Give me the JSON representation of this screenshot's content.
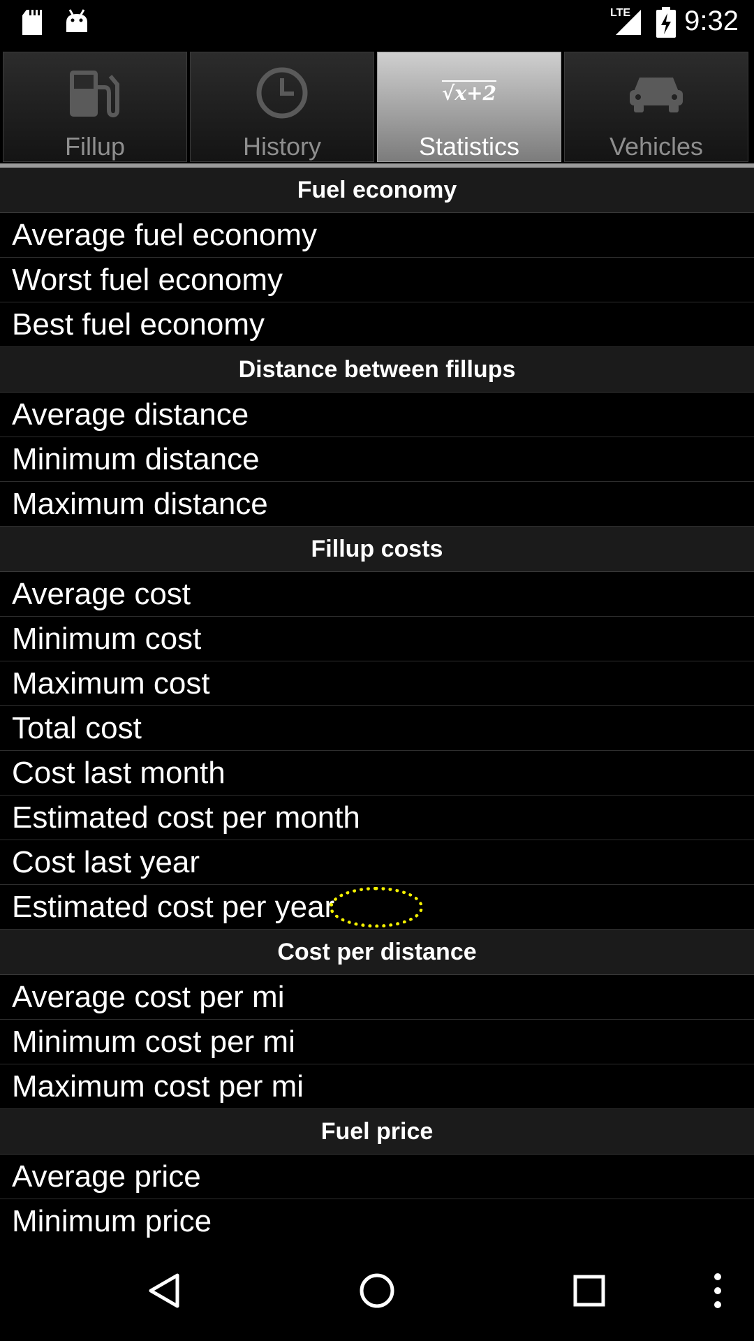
{
  "status_bar": {
    "network_label": "LTE",
    "time": "9:32"
  },
  "tabs": [
    {
      "label": "Fillup",
      "icon": "fuel-pump-icon",
      "selected": false
    },
    {
      "label": "History",
      "icon": "clock-icon",
      "selected": false
    },
    {
      "label": "Statistics",
      "icon": "formula-icon",
      "icon_text": "√x+2",
      "selected": true
    },
    {
      "label": "Vehicles",
      "icon": "car-icon",
      "selected": false
    }
  ],
  "sections": [
    {
      "title": "Fuel economy",
      "items": [
        "Average fuel economy",
        "Worst fuel economy",
        "Best fuel economy"
      ]
    },
    {
      "title": "Distance between fillups",
      "items": [
        "Average distance",
        "Minimum distance",
        "Maximum distance"
      ]
    },
    {
      "title": "Fillup costs",
      "items": [
        "Average cost",
        "Minimum cost",
        "Maximum cost",
        "Total cost",
        "Cost last month",
        "Estimated cost per month",
        "Cost last year",
        "Estimated cost per year"
      ]
    },
    {
      "title": "Cost per distance",
      "items": [
        "Average cost per mi",
        "Minimum cost per mi",
        "Maximum cost per mi"
      ]
    },
    {
      "title": "Fuel price",
      "items": [
        "Average price",
        "Minimum price"
      ]
    }
  ],
  "nav_bar": {
    "buttons": [
      "back-icon",
      "home-icon",
      "recents-icon",
      "overflow-menu-icon"
    ]
  },
  "colors": {
    "highlight_ring": "#f3f000",
    "section_header_bg": "#1b1b1b",
    "tab_inactive_text": "#8e8e8e"
  }
}
